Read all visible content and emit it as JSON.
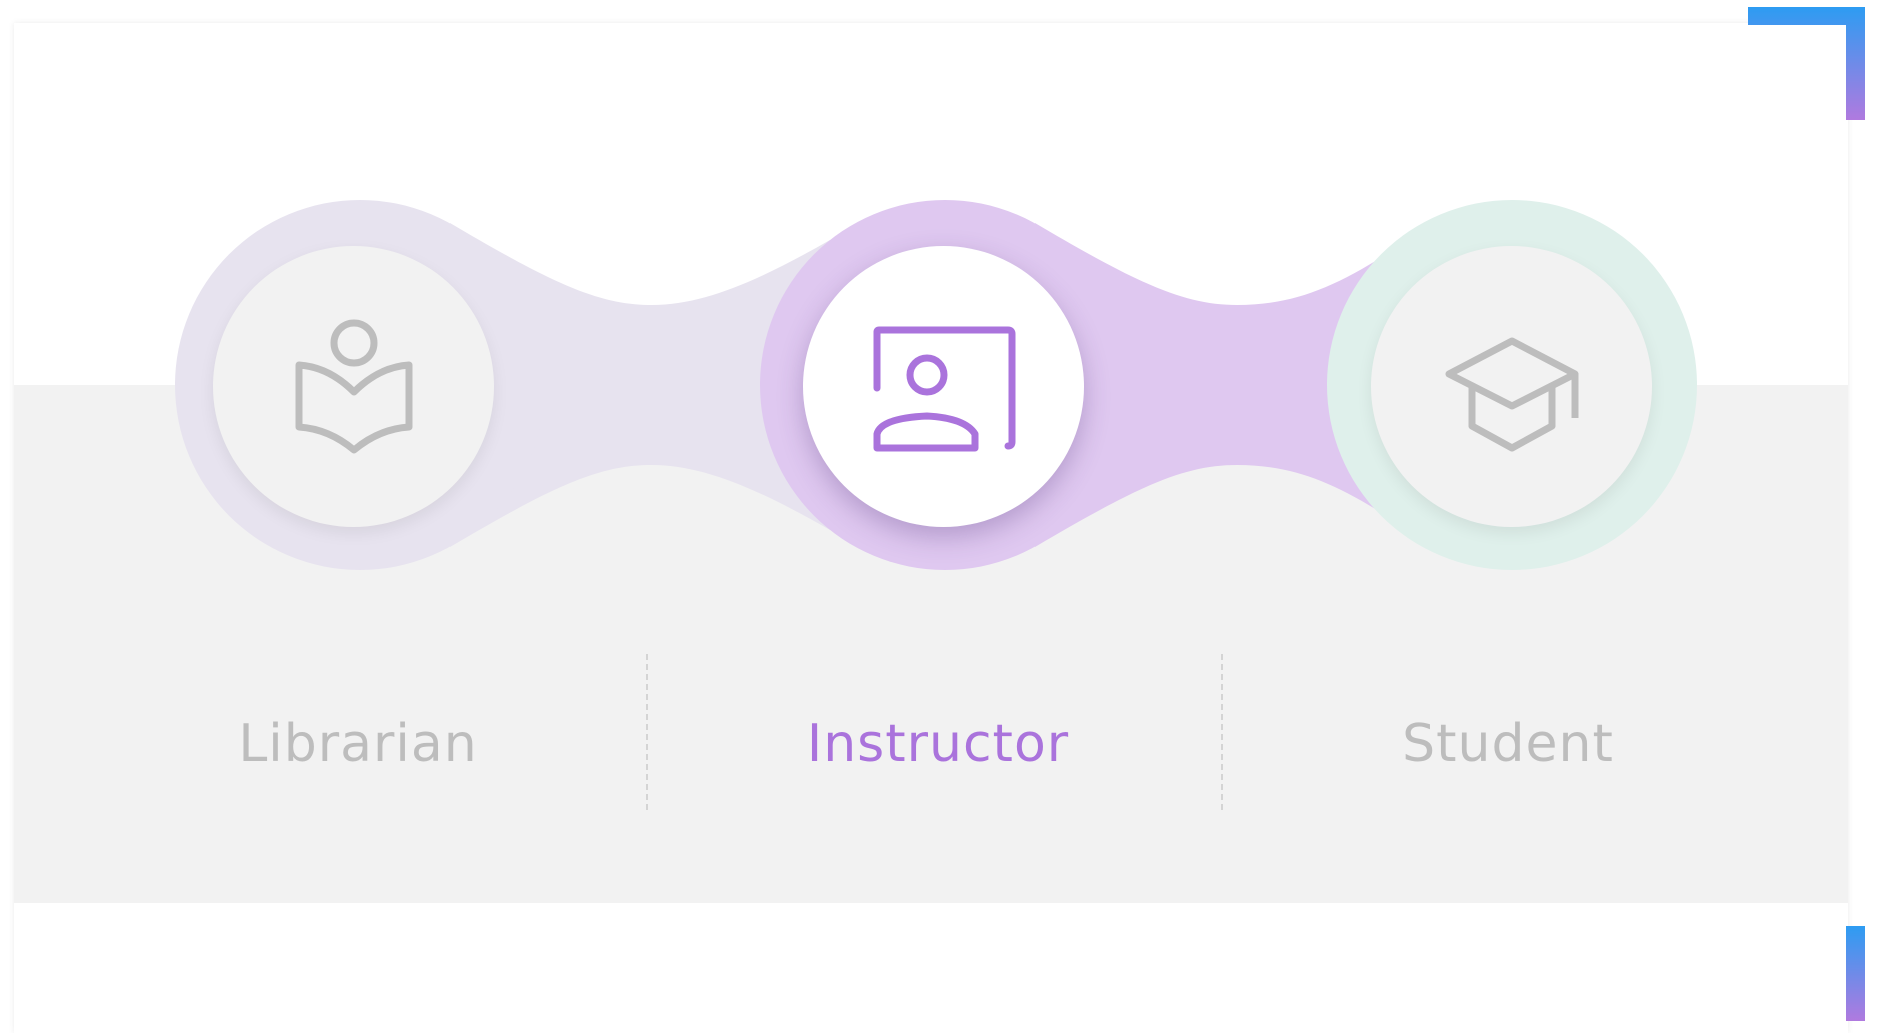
{
  "roles": [
    {
      "id": "librarian",
      "label": "Librarian",
      "icon": "book-reader-icon",
      "active": false,
      "halo_color": "#e7e3ef"
    },
    {
      "id": "instructor",
      "label": "Instructor",
      "icon": "presenter-board-icon",
      "active": true,
      "halo_color": "#dfc8f0"
    },
    {
      "id": "student",
      "label": "Student",
      "icon": "graduation-cap-icon",
      "active": false,
      "halo_color": "#dff0eb"
    }
  ],
  "colors": {
    "accent": "#aa73dc",
    "inactive": "#bdbdbd",
    "band": "#f2f2f2",
    "corner_accent_start": "#2d9cf2",
    "corner_accent_end": "#b07adf"
  }
}
